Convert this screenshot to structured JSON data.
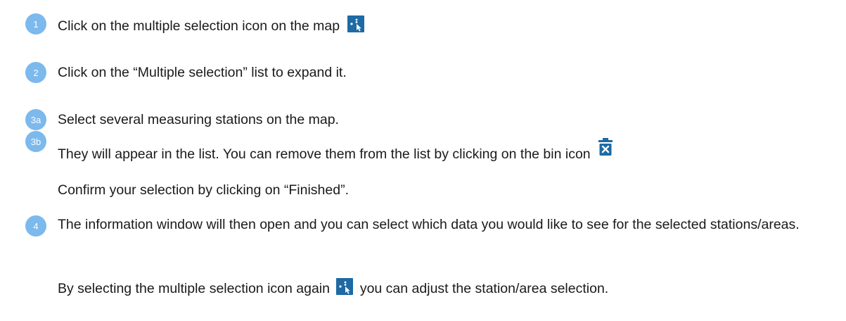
{
  "steps": {
    "s1": {
      "badge": "1",
      "text": "Click on the multiple selection icon on the map",
      "icon": "multi-select-icon"
    },
    "s2": {
      "badge": "2",
      "text": "Click on the “Multiple selection” list to expand it."
    },
    "s3a": {
      "badge": "3a",
      "text": "Select several measuring stations on the map."
    },
    "s3b": {
      "badge": "3b",
      "text": "They will appear in the list. You can remove them from the list by clicking on the bin icon",
      "icon": "bin-icon"
    },
    "confirm": {
      "text": "Confirm your selection by clicking on “Finished”."
    },
    "s4": {
      "badge": "4",
      "text": "The information window will then open and you can select which data you would like to see for the selected stations/areas."
    },
    "adjust": {
      "text_before": "By selecting the multiple selection icon again",
      "text_after": "you can adjust the station/area selection.",
      "icon": "multi-select-icon"
    }
  },
  "colors": {
    "badge": "#7cb9ec",
    "icon_blue": "#1d6aa4",
    "text": "#1a1a1a"
  }
}
